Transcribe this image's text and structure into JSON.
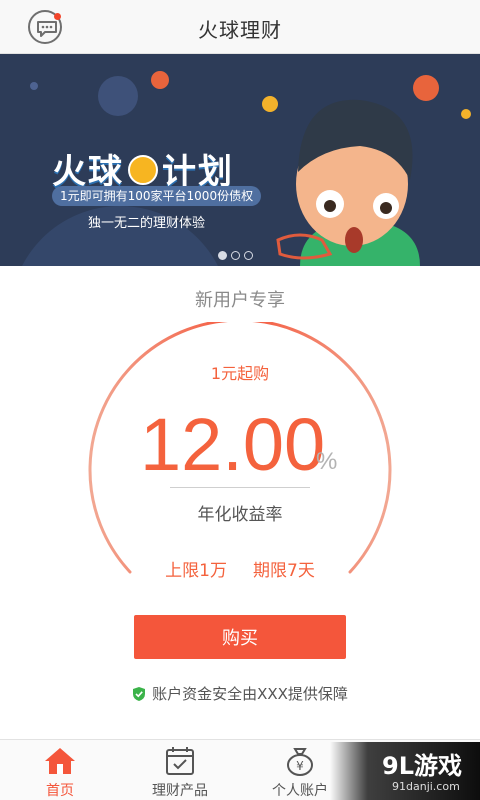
{
  "header": {
    "title": "火球理财",
    "message_icon": "message-icon"
  },
  "banner": {
    "title_part1": "火球",
    "title_part2": "计划",
    "pill_text": "1元即可拥有100家平台1000份债权",
    "subtitle": "独一无二的理财体验",
    "carousel_total": 3,
    "carousel_active": 1
  },
  "offer": {
    "section_title": "新用户专享",
    "start_label": "1元起购",
    "rate_value": "12.00",
    "rate_unit": "%",
    "rate_label": "年化收益率",
    "upper_limit": "上限1万",
    "term": "期限7天",
    "buy_label": "购买",
    "safety_text": "账户资金安全由XXX提供保障"
  },
  "tabs": [
    {
      "label": "首页",
      "icon": "home-icon",
      "active": true
    },
    {
      "label": "理财产品",
      "icon": "calendar-check-icon",
      "active": false
    },
    {
      "label": "个人账户",
      "icon": "money-bag-icon",
      "active": false
    }
  ],
  "watermark": {
    "brand": "9L游戏",
    "url": "91danji.com"
  },
  "colors": {
    "accent": "#f4563b",
    "banner_bg": "#2d3c58",
    "safe_green": "#3bb34a"
  }
}
